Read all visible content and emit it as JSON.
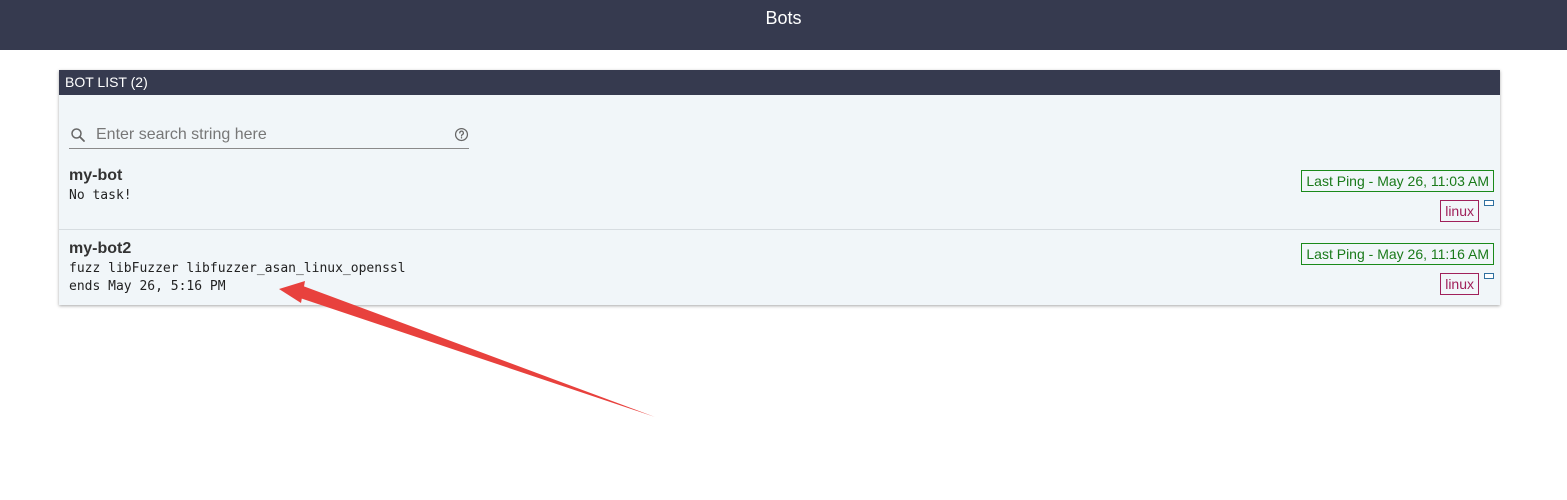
{
  "header": {
    "title": "Bots"
  },
  "panel": {
    "title": "BOT LIST (2)",
    "search": {
      "placeholder": "Enter search string here",
      "value": ""
    }
  },
  "bots": [
    {
      "name": "my-bot",
      "task_line1": "No task!",
      "task_line2": "",
      "last_ping": "Last Ping - May 26, 11:03 AM",
      "platform": "linux"
    },
    {
      "name": "my-bot2",
      "task_line1": "fuzz libFuzzer libfuzzer_asan_linux_openssl",
      "task_line2": "ends May 26, 5:16 PM",
      "last_ping": "Last Ping - May 26, 11:16 AM",
      "platform": "linux"
    }
  ],
  "colors": {
    "header_bg": "#363a4f",
    "panel_bg": "#f1f6f9",
    "ping_green": "#1a8a1a",
    "tag_magenta": "#a0205a",
    "annotation_red": "#e8413d"
  },
  "icons": {
    "search": "search-icon",
    "help": "help-circle-icon",
    "annotation": "red-arrow-icon"
  }
}
